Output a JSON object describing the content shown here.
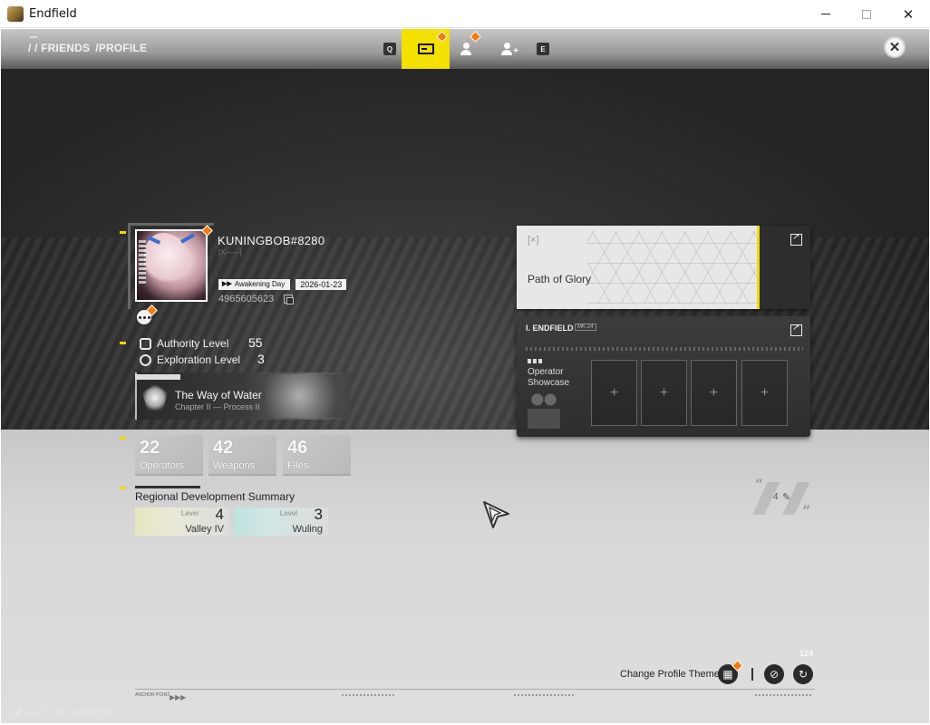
{
  "window": {
    "title": "Endfield",
    "minimize_glyph": "",
    "close_glyph": "✕"
  },
  "header": {
    "breadcrumb": [
      "/ / FRIENDS",
      "/PROFILE"
    ],
    "tabs": [
      {
        "key": "Q",
        "icon": "key-hint-icon"
      },
      {
        "key": "",
        "icon": "profile-card-icon",
        "active": true,
        "badge": true
      },
      {
        "key": "",
        "icon": "friends-icon",
        "badge": true
      },
      {
        "key": "",
        "icon": "add-friend-icon",
        "badge": false
      },
      {
        "key": "E",
        "icon": "key-hint-icon"
      }
    ],
    "exit_glyph": "✕"
  },
  "profile": {
    "username": "KUNINGBOB#8280",
    "tag": "[X——]",
    "awakening_label": "Awakening Day",
    "awakening_date": "2026-01-23",
    "uid": "4965605623",
    "levels": [
      {
        "label": "Authority Level",
        "value": "55",
        "icon": "authority-icon"
      },
      {
        "label": "Exploration Level",
        "value": "3",
        "icon": "exploration-icon"
      }
    ],
    "story": {
      "title": "The Way of Water",
      "subtitle": "Chapter II — Process II"
    },
    "stats": [
      {
        "value": "22",
        "label": "Operators"
      },
      {
        "value": "42",
        "label": "Weapons"
      },
      {
        "value": "46",
        "label": "Files"
      }
    ],
    "region_title": "Regional Development Summary",
    "regions": [
      {
        "level_label": "Level",
        "level": "4",
        "name": "Valley IV",
        "tint": "#e6e6c0"
      },
      {
        "level_label": "Level",
        "level": "3",
        "name": "Wuling",
        "tint": "#bfe3df"
      }
    ]
  },
  "cards": {
    "glory_title": "Path of Glory",
    "glory_logo": "[×]",
    "showcase_brand": "I. ENDFIELD",
    "showcase_brand_tag": "MK-24",
    "showcase_label": "Operator Showcase",
    "slot_glyph": "+"
  },
  "quote": {
    "open": "“",
    "close": "”",
    "count": "4",
    "edit_glyph": "✎"
  },
  "footer": {
    "change_theme_label": "Change Profile Theme",
    "anchor_label": "ANCHOR POINT",
    "deco_number": "124",
    "ping": "22ms",
    "uid_footer": "UID: 4965605623"
  },
  "colors": {
    "accent_yellow": "#f4e100",
    "badge_orange": "#f07c15"
  }
}
